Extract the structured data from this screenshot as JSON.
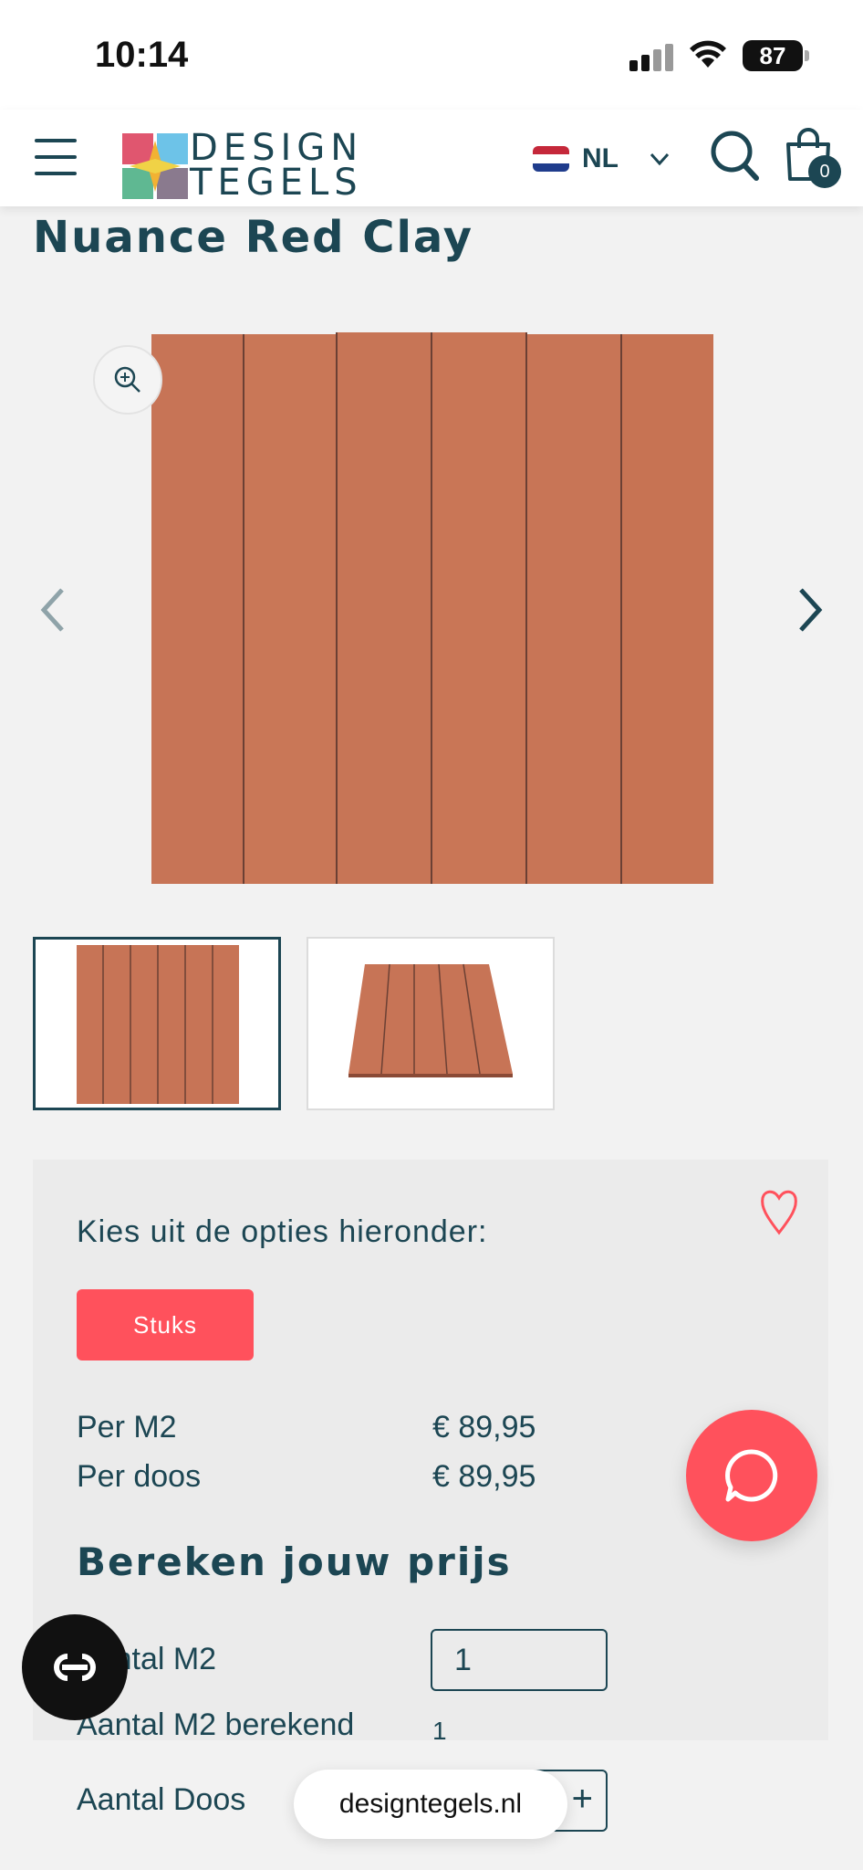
{
  "status_bar": {
    "time": "10:14",
    "battery": "87"
  },
  "header": {
    "logo_line1": "DESIGN",
    "logo_line2": "TEGELS",
    "language": "NL",
    "cart_count": "0",
    "icons": [
      "menu-icon",
      "search-icon",
      "cart-icon",
      "chevron-down-icon"
    ]
  },
  "product": {
    "title": "Nuance Red Clay"
  },
  "options": {
    "choose_label": "Kies uit de opties hieronder:",
    "unit_button": "Stuks",
    "prices": [
      {
        "label": "Per M2",
        "value": "€ 89,95"
      },
      {
        "label": "Per doos",
        "value": "€ 89,95"
      }
    ]
  },
  "calculator": {
    "title": "Bereken jouw prijs",
    "m2_label": "Aantal M2",
    "m2_value": "1",
    "m2_calc_label": "Aantal M2 berekend",
    "m2_calc_value": "1",
    "doos_label": "Aantal Doos",
    "plus_symbol": "+"
  },
  "browser": {
    "url": "designtegels.nl"
  },
  "colors": {
    "brand": "#1c4653",
    "accent": "#ff515c",
    "tile": "#c87456"
  }
}
